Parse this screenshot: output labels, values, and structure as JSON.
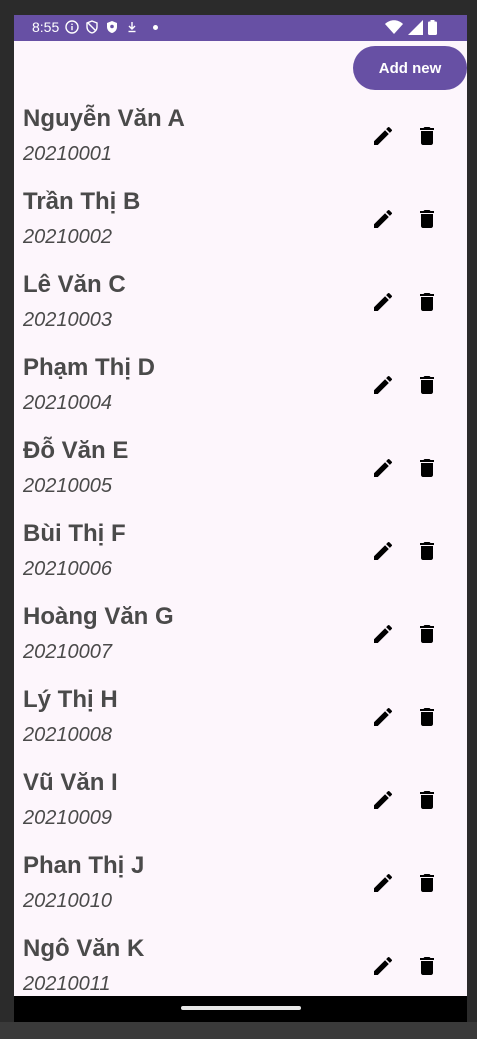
{
  "status_bar": {
    "time": "8:55",
    "icons": [
      "info-icon",
      "shield-icon",
      "shield-filled-icon",
      "download-icon"
    ],
    "right_icons": [
      "wifi-icon",
      "signal-icon",
      "battery-icon"
    ]
  },
  "toolbar": {
    "add_label": "Add new"
  },
  "students": [
    {
      "name": "Nguyễn Văn A",
      "id": "20210001"
    },
    {
      "name": "Trần Thị B",
      "id": "20210002"
    },
    {
      "name": "Lê Văn C",
      "id": "20210003"
    },
    {
      "name": "Phạm Thị D",
      "id": "20210004"
    },
    {
      "name": "Đỗ Văn E",
      "id": "20210005"
    },
    {
      "name": "Bùi Thị F",
      "id": "20210006"
    },
    {
      "name": "Hoàng Văn G",
      "id": "20210007"
    },
    {
      "name": "Lý Thị H",
      "id": "20210008"
    },
    {
      "name": "Vũ Văn I",
      "id": "20210009"
    },
    {
      "name": "Phan Thị J",
      "id": "20210010"
    },
    {
      "name": "Ngô Văn K",
      "id": "20210011"
    }
  ],
  "row_actions": {
    "edit_icon": "pencil-icon",
    "delete_icon": "trash-icon"
  },
  "colors": {
    "accent": "#6750a4",
    "background": "#fdf6fc",
    "text": "#4a4a4a"
  }
}
